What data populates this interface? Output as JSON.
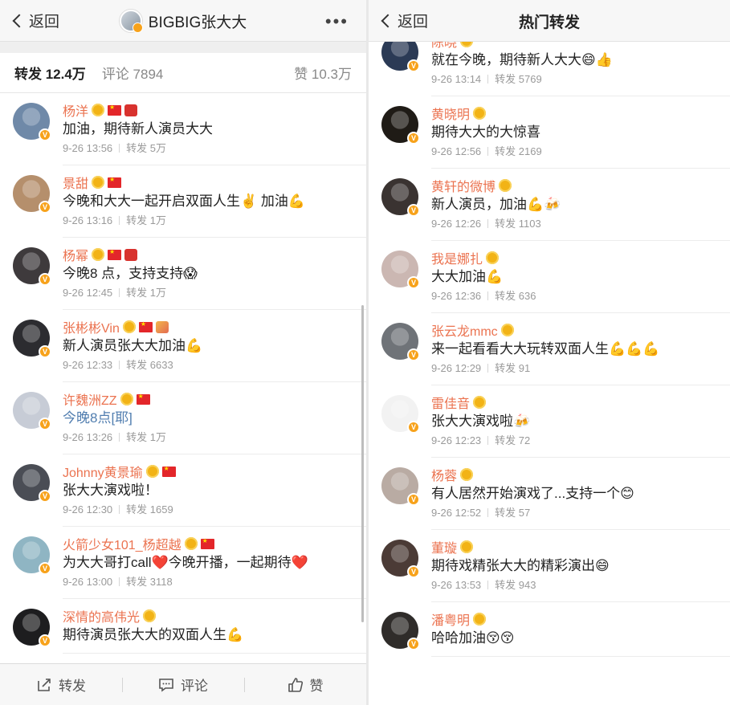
{
  "left": {
    "back_label": "返回",
    "title": "BIGBIG张大大",
    "more_label": "•••",
    "tabs": [
      {
        "label": "转发 12.4万"
      },
      {
        "label": "评论 7894"
      },
      {
        "label": "赞 10.3万"
      }
    ],
    "items": [
      {
        "name": "杨洋",
        "text": "加油，期待新人演员大大",
        "time": "9-26 13:56",
        "forward": "转发 5万",
        "avatar": "#6f89a8",
        "badges": [
          "v",
          "flag",
          "omega"
        ]
      },
      {
        "name": "景甜",
        "text": "今晚和大大一起开启双面人生✌️ 加油💪",
        "time": "9-26 13:16",
        "forward": "转发 1万",
        "avatar": "#b58f6c",
        "badges": [
          "v",
          "flag"
        ]
      },
      {
        "name": "杨幂",
        "text": "今晚8 点，支持支持😱",
        "time": "9-26 12:45",
        "forward": "转发 1万",
        "avatar": "#3e3a3c",
        "badges": [
          "v",
          "flag",
          "omega"
        ]
      },
      {
        "name": "张彬彬Vin",
        "text": "新人演员张大大加油💪",
        "time": "9-26 12:33",
        "forward": "转发 6633",
        "avatar": "#2c2c30",
        "badges": [
          "v",
          "flag",
          "bouquet"
        ]
      },
      {
        "name": "许魏洲ZZ",
        "text": "今晚8点[耶]",
        "time": "9-26 13:26",
        "forward": "转发 1万",
        "avatar": "#c7ccd6",
        "badges": [
          "v",
          "flag"
        ],
        "link": true
      },
      {
        "name": "Johnny黄景瑜",
        "text": "张大大演戏啦！",
        "time": "9-26 12:30",
        "forward": "转发 1659",
        "avatar": "#4a4d55",
        "badges": [
          "v",
          "flag"
        ]
      },
      {
        "name": "火箭少女101_杨超越",
        "text": "为大大哥打call❤️今晚开播，一起期待❤️",
        "time": "9-26 13:00",
        "forward": "转发 3118",
        "avatar": "#8fb5c3",
        "badges": [
          "v",
          "flag"
        ]
      },
      {
        "name": "深情的高伟光",
        "text": "期待演员张大大的双面人生💪",
        "time": "",
        "forward": "",
        "avatar": "#1d1d1f",
        "badges": [
          "v"
        ]
      }
    ],
    "bottom": [
      {
        "label": "转发"
      },
      {
        "label": "评论"
      },
      {
        "label": "赞"
      }
    ]
  },
  "right": {
    "back_label": "返回",
    "title": "热门转发",
    "items": [
      {
        "name": "陈晓",
        "text": "就在今晚，期待新人大大😄👍",
        "time": "9-26 13:14",
        "forward": "转发 5769",
        "avatar": "#2b3a55",
        "badges": [
          "v"
        ]
      },
      {
        "name": "黄晓明",
        "text": "期待大大的大惊喜",
        "time": "9-26 12:56",
        "forward": "转发 2169",
        "avatar": "#1f1b16",
        "badges": [
          "v"
        ]
      },
      {
        "name": "黄轩的微博",
        "text": "新人演员，加油💪🍻",
        "time": "9-26 12:26",
        "forward": "转发 1103",
        "avatar": "#3a3331",
        "badges": [
          "v"
        ]
      },
      {
        "name": "我是娜扎",
        "text": "大大加油💪",
        "time": "9-26 12:36",
        "forward": "转发 636",
        "avatar": "#cbb7b2",
        "badges": [
          "v"
        ]
      },
      {
        "name": "张云龙mmc",
        "text": "来一起看看大大玩转双面人生💪💪💪",
        "time": "9-26 12:29",
        "forward": "转发 91",
        "avatar": "#6f7378",
        "badges": [
          "v"
        ]
      },
      {
        "name": "雷佳音",
        "text": "张大大演戏啦🍻",
        "time": "9-26 12:23",
        "forward": "转发 72",
        "avatar": "#f2f2f2",
        "badges": [
          "v"
        ]
      },
      {
        "name": "杨蓉",
        "text": "有人居然开始演戏了...支持一个😊",
        "time": "9-26 12:52",
        "forward": "转发 57",
        "avatar": "#b9aba3",
        "badges": [
          "v"
        ]
      },
      {
        "name": "董璇",
        "text": "期待戏精张大大的精彩演出😄",
        "time": "9-26 13:53",
        "forward": "转发 943",
        "avatar": "#4b3b36",
        "badges": [
          "v"
        ]
      },
      {
        "name": "潘粤明",
        "text": "哈哈加油😚😚",
        "time": "",
        "forward": "",
        "avatar": "#2f2c2a",
        "badges": [
          "v"
        ]
      }
    ]
  },
  "colors": {
    "username": "#eb7350",
    "link": "#507daf",
    "verified": "#f7a21b"
  }
}
